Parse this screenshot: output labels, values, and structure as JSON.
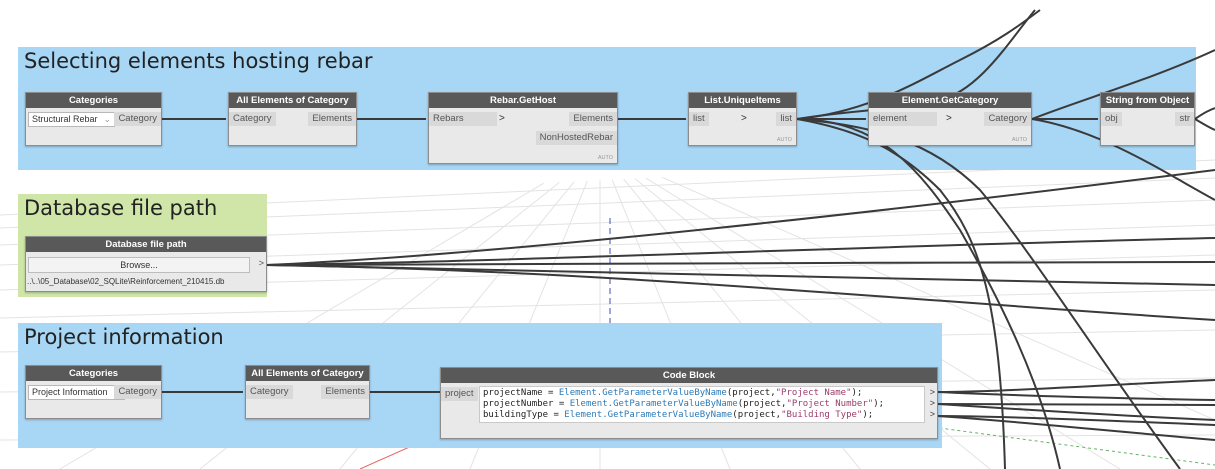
{
  "groups": {
    "rebar": {
      "title": "Selecting elements hosting rebar",
      "color": "#a8d6f5"
    },
    "db": {
      "title": "Database file path",
      "color": "#cfe6a8"
    },
    "project": {
      "title": "Project information",
      "color": "#a8d6f5"
    }
  },
  "nodes": {
    "categories1": {
      "title": "Categories",
      "selected": "Structural Rebar",
      "output": "Category"
    },
    "all_elements1": {
      "title": "All Elements of Category",
      "input": "Category",
      "output": "Elements"
    },
    "rebar_gethost": {
      "title": "Rebar.GetHost",
      "input": "Rebars",
      "output1": "Elements",
      "output2": "NonHostedRebar",
      "lacing": "AUTO"
    },
    "unique_items": {
      "title": "List.UniqueItems",
      "input": "list",
      "output": "list",
      "lacing": "AUTO"
    },
    "get_category": {
      "title": "Element.GetCategory",
      "input": "element",
      "output": "Category",
      "lacing": "AUTO"
    },
    "string_from_object": {
      "title": "String from Object",
      "input": "obj",
      "output": "str"
    },
    "db_path": {
      "title": "Database file path",
      "button": "Browse...",
      "path": "..\\..\\05_Database\\02_SQLite\\Reinforcement_210415.db",
      "output": ">"
    },
    "categories2": {
      "title": "Categories",
      "selected": "Project Information",
      "output": "Category"
    },
    "all_elements2": {
      "title": "All Elements of Category",
      "input": "Category",
      "output": "Elements"
    },
    "code_block": {
      "title": "Code Block",
      "input": "project",
      "lines": [
        {
          "var": "projectName",
          "fn": "Element.GetParameterValueByName",
          "arg": "\"Project Name\""
        },
        {
          "var": "projectNumber",
          "fn": "Element.GetParameterValueByName",
          "arg": "\"Project Number\""
        },
        {
          "var": "buildingType",
          "fn": "Element.GetParameterValueByName",
          "arg": "\"Building Type\""
        }
      ]
    }
  }
}
